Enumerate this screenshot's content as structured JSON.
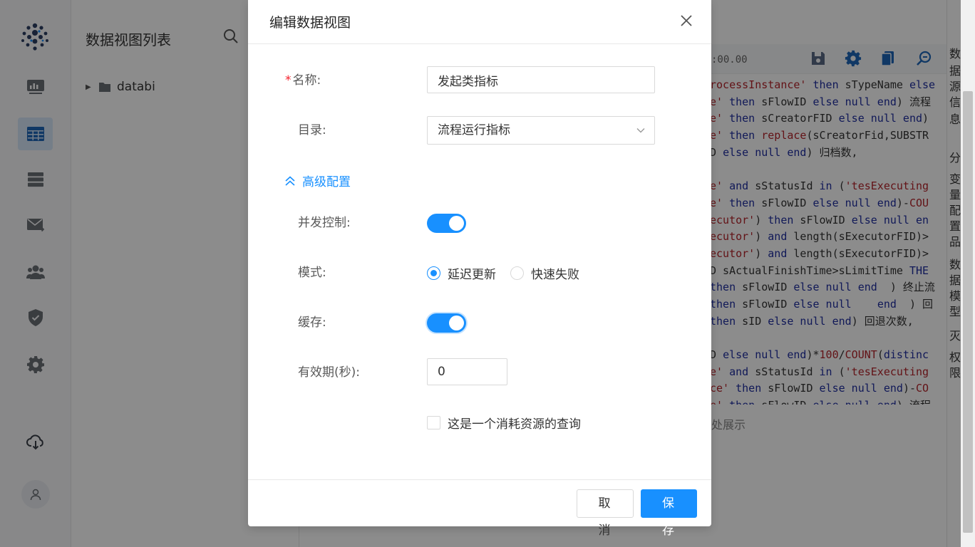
{
  "app": {
    "tree_title": "数据视图列表",
    "tree_items": [
      {
        "label": "databi"
      }
    ],
    "editor_time": ":00.00",
    "editor_hint": "处展示",
    "right_tabs": [
      "数",
      "据",
      "源",
      "信",
      "息",
      "分",
      "变",
      "量",
      "配",
      "置",
      "品",
      "数",
      "据",
      "模",
      "型",
      "灭",
      "权",
      "限"
    ],
    "code_lines": [
      [
        [
          "str",
          "rocessInstance'"
        ],
        [
          "txt",
          " "
        ],
        [
          "kw",
          "then"
        ],
        [
          "txt",
          " sTypeName "
        ],
        [
          "kw",
          "else"
        ]
      ],
      [
        [
          "str",
          "e'"
        ],
        [
          "txt",
          " "
        ],
        [
          "kw",
          "then"
        ],
        [
          "txt",
          " sFlowID "
        ],
        [
          "kw",
          "else null end"
        ],
        [
          "txt",
          ") 流程"
        ]
      ],
      [
        [
          "str",
          "e'"
        ],
        [
          "txt",
          " "
        ],
        [
          "kw",
          "then"
        ],
        [
          "txt",
          " sCreatorFID "
        ],
        [
          "kw",
          "else null end"
        ],
        [
          "txt",
          ")"
        ]
      ],
      [
        [
          "str",
          "e'"
        ],
        [
          "txt",
          " "
        ],
        [
          "kw",
          "then"
        ],
        [
          "txt",
          " "
        ],
        [
          "fn",
          "replace"
        ],
        [
          "txt",
          "(sCreatorFid,SUBSTR"
        ]
      ],
      [
        [
          "txt",
          "D "
        ],
        [
          "kw",
          "else null end"
        ],
        [
          "txt",
          ") 归档数,"
        ]
      ],
      [
        [
          "txt",
          ""
        ]
      ],
      [
        [
          "str",
          "e'"
        ],
        [
          "txt",
          " "
        ],
        [
          "kw",
          "and"
        ],
        [
          "txt",
          " sStatusId "
        ],
        [
          "kw",
          "in"
        ],
        [
          "txt",
          " ("
        ],
        [
          "str",
          "'tesExecuting"
        ]
      ],
      [
        [
          "str",
          "e'"
        ],
        [
          "txt",
          " "
        ],
        [
          "kw",
          "then"
        ],
        [
          "txt",
          " sFlowID "
        ],
        [
          "kw",
          "else null end"
        ],
        [
          "txt",
          ")-"
        ],
        [
          "fn",
          "COU"
        ]
      ],
      [
        [
          "str",
          "ecutor'"
        ],
        [
          "txt",
          ") "
        ],
        [
          "kw",
          "then"
        ],
        [
          "txt",
          " sFlowID "
        ],
        [
          "kw",
          "else null en"
        ]
      ],
      [
        [
          "str",
          "ecutor'"
        ],
        [
          "txt",
          ") "
        ],
        [
          "kw",
          "and"
        ],
        [
          "txt",
          " length(sExecutorFID)>"
        ]
      ],
      [
        [
          "str",
          "ecutor'"
        ],
        [
          "txt",
          ") "
        ],
        [
          "kw",
          "and"
        ],
        [
          "txt",
          " length(sExecutorFID)>"
        ]
      ],
      [
        [
          "txt",
          "D sActualFinishTime>sLimitTime "
        ],
        [
          "kw",
          "THE"
        ]
      ],
      [
        [
          "kw",
          "then"
        ],
        [
          "txt",
          " sFlowID "
        ],
        [
          "kw",
          "else null end"
        ],
        [
          "txt",
          "  ) 终止流"
        ]
      ],
      [
        [
          "kw",
          "then"
        ],
        [
          "txt",
          " sFlowID "
        ],
        [
          "kw",
          "else null"
        ],
        [
          "txt",
          "    "
        ],
        [
          "kw",
          "end"
        ],
        [
          "txt",
          "  ) 回"
        ]
      ],
      [
        [
          "kw",
          "then"
        ],
        [
          "txt",
          " sID "
        ],
        [
          "kw",
          "else null end"
        ],
        [
          "txt",
          ") 回退次数,"
        ]
      ],
      [
        [
          "txt",
          ""
        ]
      ],
      [
        [
          "txt",
          "D "
        ],
        [
          "kw",
          "else null end"
        ],
        [
          "txt",
          ")*"
        ],
        [
          "fn",
          "100"
        ],
        [
          "txt",
          "/"
        ],
        [
          "fn",
          "COUNT"
        ],
        [
          "txt",
          "("
        ],
        [
          "kw",
          "distinc"
        ]
      ],
      [
        [
          "str",
          "e'"
        ],
        [
          "txt",
          " "
        ],
        [
          "kw",
          "and"
        ],
        [
          "txt",
          " sStatusId "
        ],
        [
          "kw",
          "in"
        ],
        [
          "txt",
          " ("
        ],
        [
          "str",
          "'tesExecuting"
        ]
      ],
      [
        [
          "str",
          "ce'"
        ],
        [
          "txt",
          " "
        ],
        [
          "kw",
          "then"
        ],
        [
          "txt",
          " sFlowID "
        ],
        [
          "kw",
          "else null end"
        ],
        [
          "txt",
          ")-"
        ],
        [
          "fn",
          "CO"
        ]
      ],
      [
        [
          "str",
          "e'"
        ],
        [
          "txt",
          " "
        ],
        [
          "kw",
          "then"
        ],
        [
          "txt",
          " sFlowID "
        ],
        [
          "kw",
          "else null end"
        ],
        [
          "txt",
          ") 流程"
        ]
      ]
    ]
  },
  "modal": {
    "title": "编辑数据视图",
    "name_label": "名称:",
    "name_required_mark": "*",
    "name_value": "发起类指标",
    "dir_label": "目录:",
    "dir_value": "流程运行指标",
    "advanced_label": "高级配置",
    "concurrency_label": "并发控制:",
    "concurrency_on": true,
    "mode_label": "模式:",
    "mode_options": [
      "延迟更新",
      "快速失败"
    ],
    "mode_selected": "延迟更新",
    "cache_label": "缓存:",
    "cache_on": true,
    "ttl_label": "有效期(秒):",
    "ttl_value": "0",
    "expensive_query_label": "这是一个消耗资源的查询",
    "expensive_query_checked": false,
    "cancel_label": "取 消",
    "save_label": "保 存"
  },
  "colors": {
    "primary": "#1890ff",
    "required": "#f5222d",
    "overlay": "rgba(0,0,0,0.45)"
  }
}
